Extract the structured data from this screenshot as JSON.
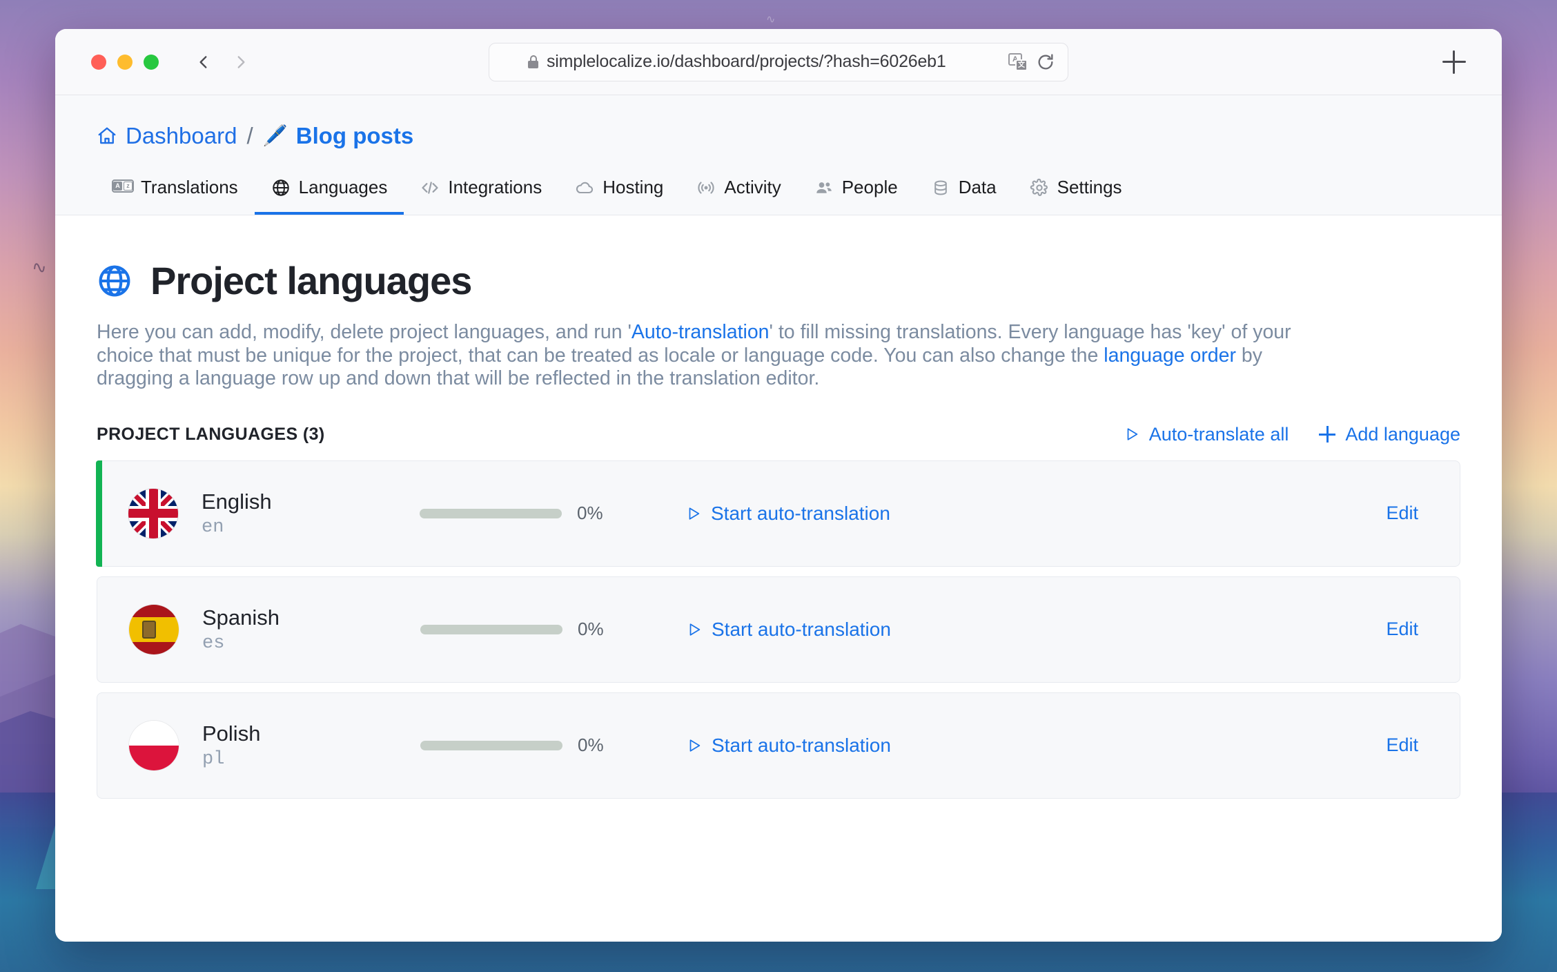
{
  "browser": {
    "url": "simplelocalize.io/dashboard/projects/?hash=6026eb1",
    "lock_icon": "lock-icon",
    "translate_icon": "translate-page-icon",
    "translate_glyph_a": "A",
    "translate_glyph_b": "文",
    "reload_icon": "reload-icon",
    "back_icon": "chevron-left-icon",
    "forward_icon": "chevron-right-icon",
    "new_tab_icon": "plus-icon"
  },
  "breadcrumb": {
    "home_icon": "home-icon",
    "dashboard": "Dashboard",
    "separator": "/",
    "project_emoji": "🖊️",
    "project": "Blog posts"
  },
  "tabs": [
    {
      "label": "Translations",
      "icon": "translate-icon",
      "active": false
    },
    {
      "label": "Languages",
      "icon": "globe-icon",
      "active": true
    },
    {
      "label": "Integrations",
      "icon": "code-icon",
      "active": false
    },
    {
      "label": "Hosting",
      "icon": "cloud-icon",
      "active": false
    },
    {
      "label": "Activity",
      "icon": "broadcast-icon",
      "active": false
    },
    {
      "label": "People",
      "icon": "people-icon",
      "active": false
    },
    {
      "label": "Data",
      "icon": "database-icon",
      "active": false
    },
    {
      "label": "Settings",
      "icon": "gear-icon",
      "active": false
    }
  ],
  "page": {
    "title_icon": "globe-icon",
    "title": "Project languages",
    "description": {
      "part1": "Here you can add, modify, delete project languages, and run '",
      "link1": "Auto-translation",
      "part2": "' to fill missing translations. Every language has 'key' of your choice that must be unique for the project, that can be treated as locale or language code. You can also change the ",
      "link2": "language order",
      "part3": " by dragging a language row up and down that will be reflected in the translation editor."
    }
  },
  "section": {
    "title": "PROJECT LANGUAGES (3)",
    "auto_translate_all": "Auto-translate all",
    "auto_translate_all_icon": "play-icon",
    "add_language": "Add language",
    "add_language_icon": "plus-icon"
  },
  "languages": [
    {
      "name": "English",
      "code": "en",
      "flag": "flag-uk",
      "progress": 0,
      "progress_label": "0%",
      "action": "Start auto-translation",
      "action_icon": "play-icon",
      "edit": "Edit",
      "primary": true
    },
    {
      "name": "Spanish",
      "code": "es",
      "flag": "flag-es",
      "progress": 0,
      "progress_label": "0%",
      "action": "Start auto-translation",
      "action_icon": "play-icon",
      "edit": "Edit",
      "primary": false
    },
    {
      "name": "Polish",
      "code": "pl",
      "flag": "flag-pl",
      "progress": 0,
      "progress_label": "0%",
      "action": "Start auto-translation",
      "action_icon": "play-icon",
      "edit": "Edit",
      "primary": false
    }
  ],
  "colors": {
    "accent_blue": "#1a73e8",
    "primary_green": "#12b353",
    "text_dark": "#20232a",
    "text_muted": "#7b8ba0"
  }
}
